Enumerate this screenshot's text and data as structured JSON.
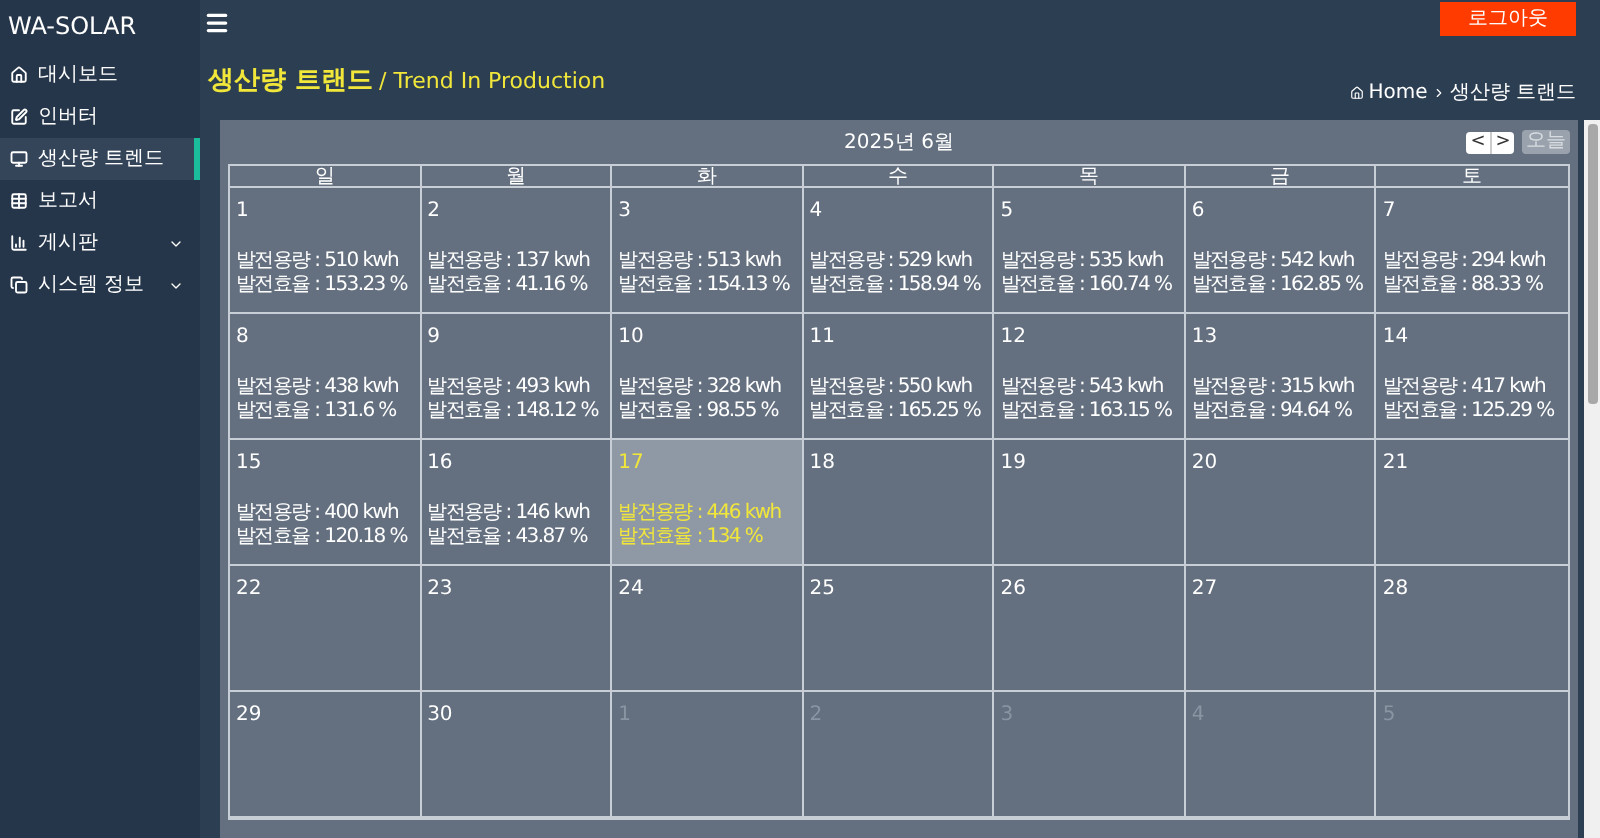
{
  "brand": "WA-SOLAR",
  "logout": "로그아웃",
  "sidebar": {
    "items": [
      {
        "label": "대시보드",
        "selected": false,
        "expandable": false
      },
      {
        "label": "인버터",
        "selected": false,
        "expandable": false
      },
      {
        "label": "생산량 트렌드",
        "selected": true,
        "expandable": false
      },
      {
        "label": "보고서",
        "selected": false,
        "expandable": false
      },
      {
        "label": "게시판",
        "selected": false,
        "expandable": true
      },
      {
        "label": "시스템 정보",
        "selected": false,
        "expandable": true
      }
    ]
  },
  "page_title": "생산량 트랜드",
  "page_subtitle": "/ Trend In Production",
  "breadcrumb": [
    "Home",
    "생산량 트랜드"
  ],
  "calendar": {
    "month": "2025년 6월",
    "prev": "<",
    "next": ">",
    "today": "오늘",
    "weekdays": [
      "일",
      "월",
      "화",
      "수",
      "목",
      "금",
      "토"
    ],
    "days": [
      {
        "kind": "current",
        "date": "1",
        "selected": false,
        "production": "발전용량 : 510 kwh",
        "efficiency": "발전효율 : 153.23 %"
      },
      {
        "kind": "current",
        "date": "2",
        "selected": false,
        "production": "발전용량 : 137 kwh",
        "efficiency": "발전효율 : 41.16 %"
      },
      {
        "kind": "current",
        "date": "3",
        "selected": false,
        "production": "발전용량 : 513 kwh",
        "efficiency": "발전효율 : 154.13 %"
      },
      {
        "kind": "current",
        "date": "4",
        "selected": false,
        "production": "발전용량 : 529 kwh",
        "efficiency": "발전효율 : 158.94 %"
      },
      {
        "kind": "current",
        "date": "5",
        "selected": false,
        "production": "발전용량 : 535 kwh",
        "efficiency": "발전효율 : 160.74 %"
      },
      {
        "kind": "current",
        "date": "6",
        "selected": false,
        "production": "발전용량 : 542 kwh",
        "efficiency": "발전효율 : 162.85 %"
      },
      {
        "kind": "current",
        "date": "7",
        "selected": false,
        "production": "발전용량 : 294 kwh",
        "efficiency": "발전효율 : 88.33 %"
      },
      {
        "kind": "current",
        "date": "8",
        "selected": false,
        "production": "발전용량 : 438 kwh",
        "efficiency": "발전효율 : 131.6 %"
      },
      {
        "kind": "current",
        "date": "9",
        "selected": false,
        "production": "발전용량 : 493 kwh",
        "efficiency": "발전효율 : 148.12 %"
      },
      {
        "kind": "current",
        "date": "10",
        "selected": false,
        "production": "발전용량 : 328 kwh",
        "efficiency": "발전효율 : 98.55 %"
      },
      {
        "kind": "current",
        "date": "11",
        "selected": false,
        "production": "발전용량 : 550 kwh",
        "efficiency": "발전효율 : 165.25 %"
      },
      {
        "kind": "current",
        "date": "12",
        "selected": false,
        "production": "발전용량 : 543 kwh",
        "efficiency": "발전효율 : 163.15 %"
      },
      {
        "kind": "current",
        "date": "13",
        "selected": false,
        "production": "발전용량 : 315 kwh",
        "efficiency": "발전효율 : 94.64 %"
      },
      {
        "kind": "current",
        "date": "14",
        "selected": false,
        "production": "발전용량 : 417 kwh",
        "efficiency": "발전효율 : 125.29 %"
      },
      {
        "kind": "current",
        "date": "15",
        "selected": false,
        "production": "발전용량 : 400 kwh",
        "efficiency": "발전효율 : 120.18 %"
      },
      {
        "kind": "current",
        "date": "16",
        "selected": false,
        "production": "발전용량 : 146 kwh",
        "efficiency": "발전효율 : 43.87 %"
      },
      {
        "kind": "current",
        "date": "17",
        "selected": true,
        "production": "발전용량 : 446 kwh",
        "efficiency": "발전효율 : 134 %"
      },
      {
        "kind": "current",
        "date": "18",
        "selected": false
      },
      {
        "kind": "current",
        "date": "19",
        "selected": false
      },
      {
        "kind": "current",
        "date": "20",
        "selected": false
      },
      {
        "kind": "current",
        "date": "21",
        "selected": false
      },
      {
        "kind": "current",
        "date": "22",
        "selected": false
      },
      {
        "kind": "current",
        "date": "23",
        "selected": false
      },
      {
        "kind": "current",
        "date": "24",
        "selected": false
      },
      {
        "kind": "current",
        "date": "25",
        "selected": false
      },
      {
        "kind": "current",
        "date": "26",
        "selected": false
      },
      {
        "kind": "current",
        "date": "27",
        "selected": false
      },
      {
        "kind": "current",
        "date": "28",
        "selected": false
      },
      {
        "kind": "current",
        "date": "29",
        "selected": false
      },
      {
        "kind": "current",
        "date": "30",
        "selected": false
      },
      {
        "kind": "other",
        "date": "1",
        "selected": false
      },
      {
        "kind": "other",
        "date": "2",
        "selected": false
      },
      {
        "kind": "other",
        "date": "3",
        "selected": false
      },
      {
        "kind": "other",
        "date": "4",
        "selected": false
      },
      {
        "kind": "other",
        "date": "5",
        "selected": false
      }
    ]
  }
}
